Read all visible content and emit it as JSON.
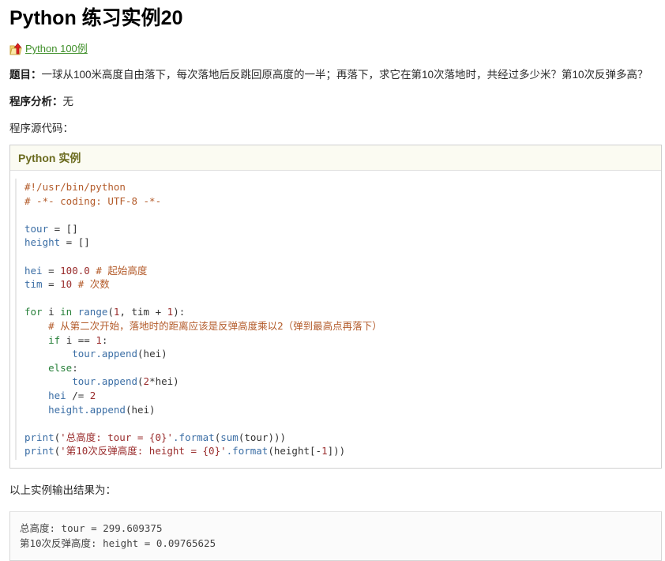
{
  "page": {
    "title": "Python 练习实例20"
  },
  "breadcrumb": {
    "icon": "folder-up-arrow-icon",
    "link_label": "Python 100例"
  },
  "content": {
    "problem_label": "题目：",
    "problem_text": "一球从100米高度自由落下，每次落地后反跳回原高度的一半；再落下，求它在第10次落地时，共经过多少米？第10次反弹多高？",
    "analysis_label": "程序分析：",
    "analysis_text": "无",
    "source_label": "程序源代码：",
    "result_label": "以上实例输出结果为："
  },
  "example": {
    "header": "Python 实例",
    "code_lines": [
      {
        "tokens": [
          {
            "c": "t-com",
            "t": "#!/usr/bin/python"
          }
        ]
      },
      {
        "tokens": [
          {
            "c": "t-com",
            "t": "# -*- coding: UTF-8 -*-"
          }
        ]
      },
      {
        "tokens": [
          {
            "c": "t-pln",
            "t": ""
          }
        ]
      },
      {
        "tokens": [
          {
            "c": "t-var",
            "t": "tour"
          },
          {
            "c": "t-pln",
            "t": " = []"
          }
        ]
      },
      {
        "tokens": [
          {
            "c": "t-var",
            "t": "height"
          },
          {
            "c": "t-pln",
            "t": " = []"
          }
        ]
      },
      {
        "tokens": [
          {
            "c": "t-pln",
            "t": ""
          }
        ]
      },
      {
        "tokens": [
          {
            "c": "t-var",
            "t": "hei"
          },
          {
            "c": "t-pln",
            "t": " = "
          },
          {
            "c": "t-num",
            "t": "100.0"
          },
          {
            "c": "t-pln",
            "t": " "
          },
          {
            "c": "t-com",
            "t": "# 起始高度"
          }
        ]
      },
      {
        "tokens": [
          {
            "c": "t-var",
            "t": "tim"
          },
          {
            "c": "t-pln",
            "t": " = "
          },
          {
            "c": "t-num",
            "t": "10"
          },
          {
            "c": "t-pln",
            "t": " "
          },
          {
            "c": "t-com",
            "t": "# 次数"
          }
        ]
      },
      {
        "tokens": [
          {
            "c": "t-pln",
            "t": ""
          }
        ]
      },
      {
        "tokens": [
          {
            "c": "t-kw",
            "t": "for"
          },
          {
            "c": "t-pln",
            "t": " i "
          },
          {
            "c": "t-kw",
            "t": "in"
          },
          {
            "c": "t-pln",
            "t": " "
          },
          {
            "c": "t-fn",
            "t": "range"
          },
          {
            "c": "t-pln",
            "t": "("
          },
          {
            "c": "t-num",
            "t": "1"
          },
          {
            "c": "t-pln",
            "t": ", tim + "
          },
          {
            "c": "t-num",
            "t": "1"
          },
          {
            "c": "t-pln",
            "t": "):"
          }
        ]
      },
      {
        "tokens": [
          {
            "c": "t-com",
            "t": "    # 从第二次开始，落地时的距离应该是反弹高度乘以2（弹到最高点再落下）"
          }
        ]
      },
      {
        "tokens": [
          {
            "c": "t-pln",
            "t": "    "
          },
          {
            "c": "t-kw",
            "t": "if"
          },
          {
            "c": "t-pln",
            "t": " i == "
          },
          {
            "c": "t-num",
            "t": "1"
          },
          {
            "c": "t-pln",
            "t": ":"
          }
        ]
      },
      {
        "tokens": [
          {
            "c": "t-pln",
            "t": "        "
          },
          {
            "c": "t-attr",
            "t": "tour.append"
          },
          {
            "c": "t-pln",
            "t": "(hei)"
          }
        ]
      },
      {
        "tokens": [
          {
            "c": "t-pln",
            "t": "    "
          },
          {
            "c": "t-kw",
            "t": "else"
          },
          {
            "c": "t-pln",
            "t": ":"
          }
        ]
      },
      {
        "tokens": [
          {
            "c": "t-pln",
            "t": "        "
          },
          {
            "c": "t-attr",
            "t": "tour.append"
          },
          {
            "c": "t-pln",
            "t": "("
          },
          {
            "c": "t-num",
            "t": "2"
          },
          {
            "c": "t-pln",
            "t": "*hei)"
          }
        ]
      },
      {
        "tokens": [
          {
            "c": "t-pln",
            "t": "    "
          },
          {
            "c": "t-var",
            "t": "hei"
          },
          {
            "c": "t-pln",
            "t": " /= "
          },
          {
            "c": "t-num",
            "t": "2"
          }
        ]
      },
      {
        "tokens": [
          {
            "c": "t-pln",
            "t": "    "
          },
          {
            "c": "t-attr",
            "t": "height.append"
          },
          {
            "c": "t-pln",
            "t": "(hei)"
          }
        ]
      },
      {
        "tokens": [
          {
            "c": "t-pln",
            "t": ""
          }
        ]
      },
      {
        "tokens": [
          {
            "c": "t-fn",
            "t": "print"
          },
          {
            "c": "t-pln",
            "t": "("
          },
          {
            "c": "t-str",
            "t": "'总高度: tour = {0}'"
          },
          {
            "c": "t-attr",
            "t": ".format"
          },
          {
            "c": "t-pln",
            "t": "("
          },
          {
            "c": "t-fn",
            "t": "sum"
          },
          {
            "c": "t-pln",
            "t": "(tour)))"
          }
        ]
      },
      {
        "tokens": [
          {
            "c": "t-fn",
            "t": "print"
          },
          {
            "c": "t-pln",
            "t": "("
          },
          {
            "c": "t-str",
            "t": "'第10次反弹高度: height = {0}'"
          },
          {
            "c": "t-attr",
            "t": ".format"
          },
          {
            "c": "t-pln",
            "t": "(height[-"
          },
          {
            "c": "t-num",
            "t": "1"
          },
          {
            "c": "t-pln",
            "t": "]))"
          }
        ]
      }
    ]
  },
  "output": {
    "lines": [
      "总高度: tour = 299.609375",
      "第10次反弹高度: height = 0.09765625"
    ]
  },
  "colors": {
    "link": "#3f8f29",
    "example_header_text": "#6b6b1f",
    "comment": "#b35b2a",
    "keyword": "#28803a",
    "string": "#9a2d2d",
    "identifier": "#3b6ea5"
  }
}
